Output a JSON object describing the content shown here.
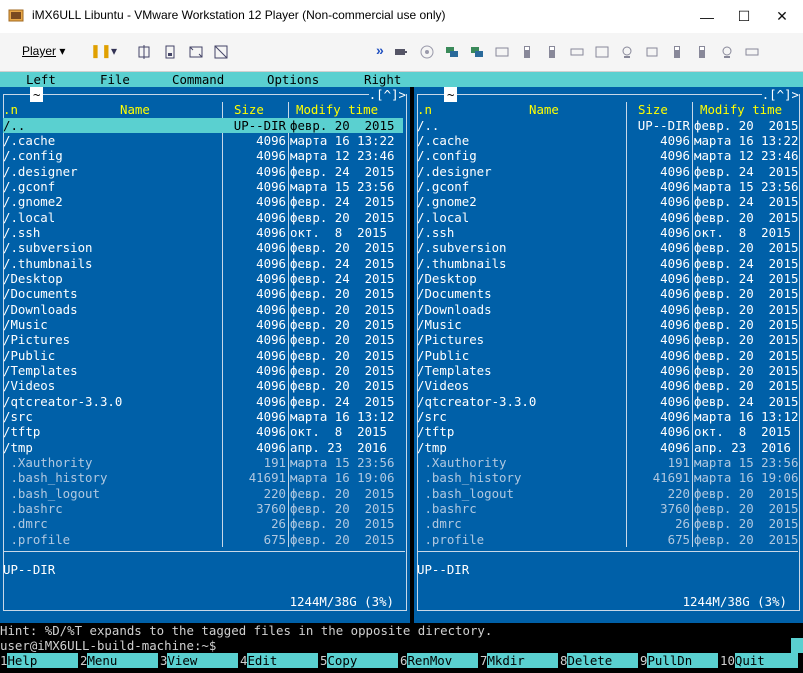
{
  "window": {
    "title": "iMX6ULL Libuntu - VMware Workstation 12 Player (Non-commercial use only)",
    "minimize": "—",
    "maximize": "☐",
    "close": "✕"
  },
  "toolbar": {
    "player_label": "Player",
    "player_arrow": "▾",
    "pause": "❚❚",
    "pause_arrow": "▾",
    "more": "»"
  },
  "menubar": {
    "left": "Left",
    "file": "File",
    "command": "Command",
    "options": "Options",
    "right": "Right"
  },
  "left_panel": {
    "top_marker": "~",
    "top_right": ".[^]>",
    "cols": {
      "n": ".n",
      "name": "Name",
      "size": "Size",
      "mtime": "Modify time"
    },
    "rows": [
      {
        "name": "/..",
        "size": "UP--DIR",
        "date": "февр. 20  2015",
        "sel": true
      },
      {
        "name": "/.cache",
        "size": "4096",
        "date": "марта 16 13:22"
      },
      {
        "name": "/.config",
        "size": "4096",
        "date": "марта 12 23:46"
      },
      {
        "name": "/.designer",
        "size": "4096",
        "date": "февр. 24  2015"
      },
      {
        "name": "/.gconf",
        "size": "4096",
        "date": "марта 15 23:56"
      },
      {
        "name": "/.gnome2",
        "size": "4096",
        "date": "февр. 24  2015"
      },
      {
        "name": "/.local",
        "size": "4096",
        "date": "февр. 20  2015"
      },
      {
        "name": "/.ssh",
        "size": "4096",
        "date": "окт.  8  2015"
      },
      {
        "name": "/.subversion",
        "size": "4096",
        "date": "февр. 20  2015"
      },
      {
        "name": "/.thumbnails",
        "size": "4096",
        "date": "февр. 24  2015"
      },
      {
        "name": "/Desktop",
        "size": "4096",
        "date": "февр. 24  2015"
      },
      {
        "name": "/Documents",
        "size": "4096",
        "date": "февр. 20  2015"
      },
      {
        "name": "/Downloads",
        "size": "4096",
        "date": "февр. 20  2015"
      },
      {
        "name": "/Music",
        "size": "4096",
        "date": "февр. 20  2015"
      },
      {
        "name": "/Pictures",
        "size": "4096",
        "date": "февр. 20  2015"
      },
      {
        "name": "/Public",
        "size": "4096",
        "date": "февр. 20  2015"
      },
      {
        "name": "/Templates",
        "size": "4096",
        "date": "февр. 20  2015"
      },
      {
        "name": "/Videos",
        "size": "4096",
        "date": "февр. 20  2015"
      },
      {
        "name": "/qtcreator-3.3.0",
        "size": "4096",
        "date": "февр. 24  2015"
      },
      {
        "name": "/src",
        "size": "4096",
        "date": "марта 16 13:12"
      },
      {
        "name": "/tftp",
        "size": "4096",
        "date": "окт.  8  2015"
      },
      {
        "name": "/tmp",
        "size": "4096",
        "date": "апр. 23  2016"
      },
      {
        "name": " .Xauthority",
        "size": "191",
        "date": "марта 15 23:56",
        "dim": true
      },
      {
        "name": " .bash_history",
        "size": "41691",
        "date": "марта 16 19:06",
        "dim": true
      },
      {
        "name": " .bash_logout",
        "size": "220",
        "date": "февр. 20  2015",
        "dim": true
      },
      {
        "name": " .bashrc",
        "size": "3760",
        "date": "февр. 20  2015",
        "dim": true
      },
      {
        "name": " .dmrc",
        "size": "26",
        "date": "февр. 20  2015",
        "dim": true
      },
      {
        "name": " .profile",
        "size": "675",
        "date": "февр. 20  2015",
        "dim": true
      }
    ],
    "status": "UP--DIR",
    "free": "1244M/38G (3%)"
  },
  "right_panel": {
    "top_marker": "~",
    "top_right": ".[^]>",
    "cols": {
      "n": ".n",
      "name": "Name",
      "size": "Size",
      "mtime": "Modify time"
    },
    "rows": [
      {
        "name": "/..",
        "size": "UP--DIR",
        "date": "февр. 20  2015"
      },
      {
        "name": "/.cache",
        "size": "4096",
        "date": "марта 16 13:22"
      },
      {
        "name": "/.config",
        "size": "4096",
        "date": "марта 12 23:46"
      },
      {
        "name": "/.designer",
        "size": "4096",
        "date": "февр. 24  2015"
      },
      {
        "name": "/.gconf",
        "size": "4096",
        "date": "марта 15 23:56"
      },
      {
        "name": "/.gnome2",
        "size": "4096",
        "date": "февр. 24  2015"
      },
      {
        "name": "/.local",
        "size": "4096",
        "date": "февр. 20  2015"
      },
      {
        "name": "/.ssh",
        "size": "4096",
        "date": "окт.  8  2015"
      },
      {
        "name": "/.subversion",
        "size": "4096",
        "date": "февр. 20  2015"
      },
      {
        "name": "/.thumbnails",
        "size": "4096",
        "date": "февр. 24  2015"
      },
      {
        "name": "/Desktop",
        "size": "4096",
        "date": "февр. 24  2015"
      },
      {
        "name": "/Documents",
        "size": "4096",
        "date": "февр. 20  2015"
      },
      {
        "name": "/Downloads",
        "size": "4096",
        "date": "февр. 20  2015"
      },
      {
        "name": "/Music",
        "size": "4096",
        "date": "февр. 20  2015"
      },
      {
        "name": "/Pictures",
        "size": "4096",
        "date": "февр. 20  2015"
      },
      {
        "name": "/Public",
        "size": "4096",
        "date": "февр. 20  2015"
      },
      {
        "name": "/Templates",
        "size": "4096",
        "date": "февр. 20  2015"
      },
      {
        "name": "/Videos",
        "size": "4096",
        "date": "февр. 20  2015"
      },
      {
        "name": "/qtcreator-3.3.0",
        "size": "4096",
        "date": "февр. 24  2015"
      },
      {
        "name": "/src",
        "size": "4096",
        "date": "марта 16 13:12"
      },
      {
        "name": "/tftp",
        "size": "4096",
        "date": "окт.  8  2015"
      },
      {
        "name": "/tmp",
        "size": "4096",
        "date": "апр. 23  2016"
      },
      {
        "name": " .Xauthority",
        "size": "191",
        "date": "марта 15 23:56",
        "dim": true
      },
      {
        "name": " .bash_history",
        "size": "41691",
        "date": "марта 16 19:06",
        "dim": true
      },
      {
        "name": " .bash_logout",
        "size": "220",
        "date": "февр. 20  2015",
        "dim": true
      },
      {
        "name": " .bashrc",
        "size": "3760",
        "date": "февр. 20  2015",
        "dim": true
      },
      {
        "name": " .dmrc",
        "size": "26",
        "date": "февр. 20  2015",
        "dim": true
      },
      {
        "name": " .profile",
        "size": "675",
        "date": "февр. 20  2015",
        "dim": true
      }
    ],
    "status": "UP--DIR",
    "free": "1244M/38G (3%)"
  },
  "hint": "Hint: %D/%T expands to the tagged files in the opposite directory.",
  "prompt": "user@iMX6ULL-build-machine:~$",
  "fkeys": [
    {
      "n": "1",
      "l": "Help"
    },
    {
      "n": "2",
      "l": "Menu"
    },
    {
      "n": "3",
      "l": "View"
    },
    {
      "n": "4",
      "l": "Edit"
    },
    {
      "n": "5",
      "l": "Copy"
    },
    {
      "n": "6",
      "l": "RenMov"
    },
    {
      "n": "7",
      "l": "Mkdir"
    },
    {
      "n": "8",
      "l": "Delete"
    },
    {
      "n": "9",
      "l": "PullDn"
    },
    {
      "n": "10",
      "l": "Quit"
    }
  ]
}
